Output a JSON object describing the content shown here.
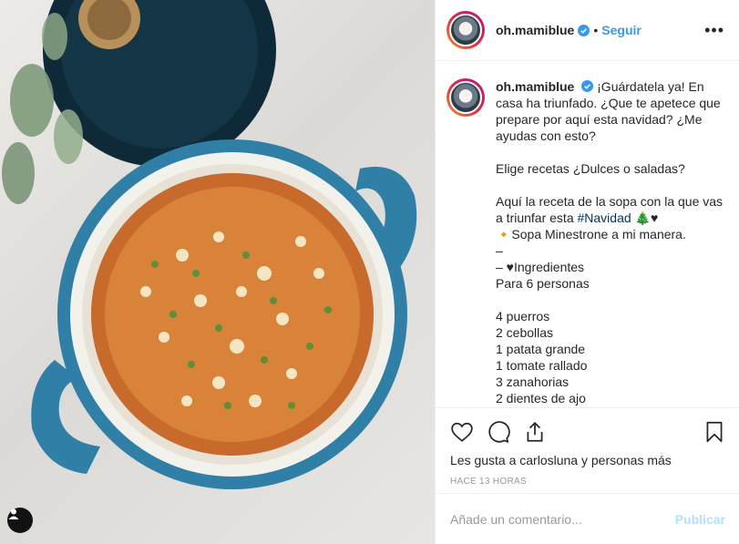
{
  "photo": {
    "alt": "Sopa minestrone en olla azul"
  },
  "account": {
    "username": "oh.mamiblue",
    "separator": "•",
    "follow_label": "Seguir",
    "more_glyph": "•••"
  },
  "caption": {
    "username": "oh.mamiblue",
    "line1": "¡Guárdatela ya! En casa ha triunfado. ¿Que te apetece que prepare por aquí esta navidad? ¿Me ayudas con esto?",
    "line2": "Elige recetas ¿Dulces o saladas?",
    "line3_pre": "Aquí la receta de la sopa con la que vas a triunfar esta ",
    "hashtag": "#Navidad",
    "line3_post": " 🎄♥",
    "line4": "🔸Sopa Minestrone a mi manera.",
    "line5": "–",
    "line6": "– ♥Ingredientes",
    "line7": "Para 6 personas",
    "ingredients": [
      "4 puerros",
      "2 cebollas",
      "1 patata grande",
      "1 tomate rallado",
      "3 zanahorias",
      "2 dientes de ajo"
    ]
  },
  "likes_text": "Les gusta a carlosluna y personas más",
  "timestamp": "HACE 13 HORAS",
  "comment_box": {
    "placeholder": "Añade un comentario...",
    "publish_label": "Publicar"
  },
  "colors": {
    "link": "#3897f0",
    "hashtag": "#003569",
    "publish_disabled": "#b2dffc",
    "pot_blue": "#2f7fa6"
  }
}
